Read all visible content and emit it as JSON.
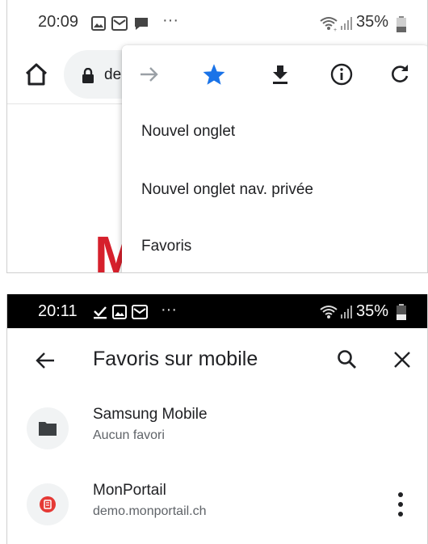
{
  "top_screen": {
    "status_bar": {
      "time": "20:09",
      "battery": "35%",
      "more": "···"
    },
    "url_bar": {
      "url_fragment": "de"
    },
    "page_logo_letter": "M",
    "menu": {
      "items": [
        {
          "label": "Nouvel onglet"
        },
        {
          "label": "Nouvel onglet nav. privée"
        },
        {
          "label": "Favoris"
        }
      ]
    }
  },
  "bottom_screen": {
    "status_bar": {
      "time": "20:11",
      "battery": "35%",
      "more": "···"
    },
    "app_bar": {
      "title": "Favoris sur mobile"
    },
    "bookmarks": [
      {
        "title": "Samsung Mobile",
        "subtitle": "Aucun favori"
      },
      {
        "title": "MonPortail",
        "subtitle": "demo.monportail.ch"
      }
    ]
  },
  "colors": {
    "star_active": "#1a73e8",
    "logo_red": "#d6202c",
    "favicon_red": "#e53935",
    "text_primary": "#202124",
    "text_secondary": "#5f6368"
  }
}
